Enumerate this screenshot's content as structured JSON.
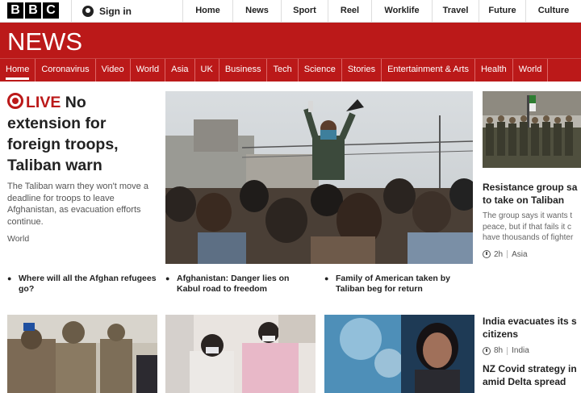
{
  "topbar": {
    "logo_letters": [
      "B",
      "B",
      "C"
    ],
    "signin_label": "Sign in",
    "nav": [
      "Home",
      "News",
      "Sport",
      "Reel",
      "Worklife",
      "Travel",
      "Future",
      "Culture"
    ]
  },
  "header": {
    "title": "NEWS"
  },
  "section_nav": {
    "items": [
      "Home",
      "Coronavirus",
      "Video",
      "World",
      "Asia",
      "UK",
      "Business",
      "Tech",
      "Science",
      "Stories",
      "Entertainment & Arts",
      "Health",
      "World"
    ],
    "active": "Home"
  },
  "lead": {
    "live_label": "LIVE",
    "headline": "No extension for foreign troops, Taliban warn",
    "summary": "The Taliban warn they won't move a deadline for troops to leave Afghanistan, as evacuation efforts continue.",
    "tag": "World"
  },
  "side_story": {
    "headline_1": "Resistance group sa",
    "headline_2": "to take on Taliban",
    "summary_1": "The group says it wants t",
    "summary_2": "peace, but if that fails it c",
    "summary_3": "have thousands of fighter",
    "time": "2h",
    "tag": "Asia"
  },
  "related": [
    "Where will all the Afghan refugees go?",
    "Afghanistan: Danger lies on Kabul road to freedom",
    "Family of American taken by Taliban beg for return"
  ],
  "row2": {
    "story_1_line_1": "India evacuates its s",
    "story_1_line_2": "citizens",
    "story_1_time": "8h",
    "story_1_tag": "India",
    "story_2_line_1": "NZ Covid strategy in",
    "story_2_line_2": "amid Delta spread"
  },
  "colors": {
    "brand_red": "#bb1919"
  }
}
